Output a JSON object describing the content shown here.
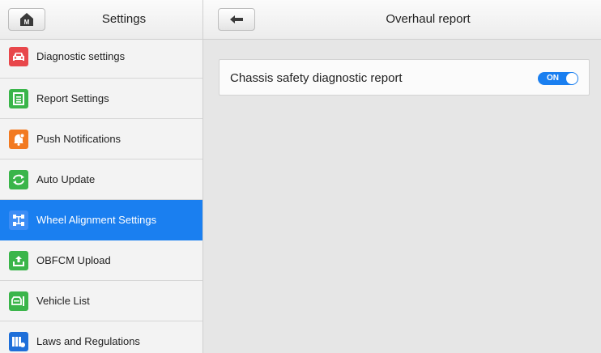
{
  "sidebar": {
    "title": "Settings",
    "home_icon_letter": "M",
    "items": [
      {
        "label": "Diagnostic settings",
        "icon": "car-icon",
        "color": "#e8474b"
      },
      {
        "label": "Report Settings",
        "icon": "document-icon",
        "color": "#3ab54a"
      },
      {
        "label": "Push Notifications",
        "icon": "bell-icon",
        "color": "#f27a21"
      },
      {
        "label": "Auto Update",
        "icon": "refresh-icon",
        "color": "#3ab54a"
      },
      {
        "label": "Wheel Alignment Settings",
        "icon": "wheel-alignment-icon",
        "color": "#1e6fd9",
        "active": true
      },
      {
        "label": "OBFCM Upload",
        "icon": "upload-icon",
        "color": "#3ab54a"
      },
      {
        "label": "Vehicle List",
        "icon": "vehicle-list-icon",
        "color": "#3ab54a"
      },
      {
        "label": "Laws and Regulations",
        "icon": "books-icon",
        "color": "#1e6fd9"
      }
    ]
  },
  "main": {
    "title": "Overhaul report",
    "report": {
      "label": "Chassis safety diagnostic report",
      "toggle_label": "ON",
      "toggle_on": true
    }
  },
  "colors": {
    "accent": "#1a7ff0",
    "background": "#e6e6e6",
    "sidebar": "#f3f3f3"
  }
}
